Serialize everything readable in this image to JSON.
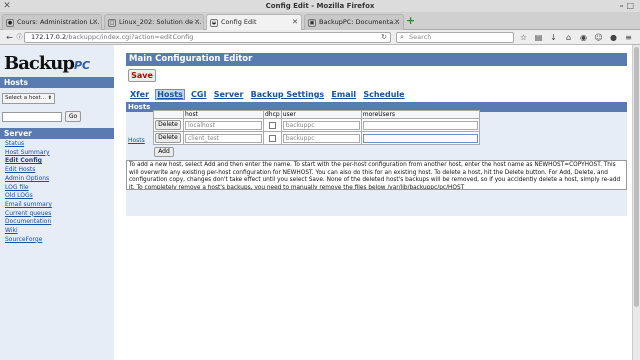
{
  "window": {
    "title": "Config Edit - Mozilla Firefox"
  },
  "tabs": [
    {
      "label": "Cours: Administration L...",
      "active": false
    },
    {
      "label": "Linux_202: Solution de ...",
      "active": false
    },
    {
      "label": "Config Edit",
      "active": true
    },
    {
      "label": "BackupPC: Documenta...",
      "active": false
    }
  ],
  "nav": {
    "url_host": "172.17.0.2",
    "url_path": "/backuppc/index.cgi?action=editConfig",
    "search_placeholder": "Search"
  },
  "sidebar": {
    "logo_main": "Backup",
    "logo_sub": "PC",
    "hosts_header": "Hosts",
    "host_select": "Select a host...",
    "go_label": "Go",
    "server_header": "Server",
    "links": [
      {
        "label": "Status",
        "bold": false
      },
      {
        "label": "Host Summary",
        "bold": false
      },
      {
        "label": "Edit Config",
        "bold": true
      },
      {
        "label": "Edit Hosts",
        "bold": false
      },
      {
        "label": "Admin Options",
        "bold": false
      },
      {
        "label": "LOG file",
        "bold": false
      },
      {
        "label": "Old LOGs",
        "bold": false
      },
      {
        "label": "Email summary",
        "bold": false
      },
      {
        "label": "Current queues",
        "bold": false
      },
      {
        "label": "Documentation",
        "bold": false
      },
      {
        "label": "Wiki",
        "bold": false
      },
      {
        "label": "SourceForge",
        "bold": false
      }
    ]
  },
  "main": {
    "title": "Main Configuration Editor",
    "save_label": "Save",
    "categories": [
      {
        "label": "Xfer",
        "selected": false
      },
      {
        "label": "Hosts",
        "selected": true
      },
      {
        "label": "CGI",
        "selected": false
      },
      {
        "label": "Server",
        "selected": false
      },
      {
        "label": "Backup Settings",
        "selected": false
      },
      {
        "label": "Email",
        "selected": false
      },
      {
        "label": "Schedule",
        "selected": false
      }
    ],
    "section_header": "Hosts",
    "hosts_link": "Hosts",
    "columns": [
      "host",
      "dhcp",
      "user",
      "moreUsers"
    ],
    "rows": [
      {
        "delete_label": "Delete",
        "host": "localhost",
        "dhcp": false,
        "user": "backuppc",
        "moreUsers": ""
      },
      {
        "delete_label": "Delete",
        "host": "client_test",
        "dhcp": false,
        "user": "backuppc",
        "moreUsers": ""
      }
    ],
    "add_label": "Add",
    "help": "To add a new host, select Add and then enter the name. To start with the per-host configuration from another host, enter the host name as NEWHOST=COPYHOST. This will overwrite any existing per-host configuration for NEWHOST. You can also do this for an existing host. To delete a host, hit the Delete button. For Add, Delete, and configuration copy, changes don't take effect until you select Save. None of the deleted host's backups will be removed, so if you accidently delete a host, simply re-add it. To completely remove a host's backups, you need to manually remove the files below /var/lib/backuppc/pc/HOST"
  }
}
